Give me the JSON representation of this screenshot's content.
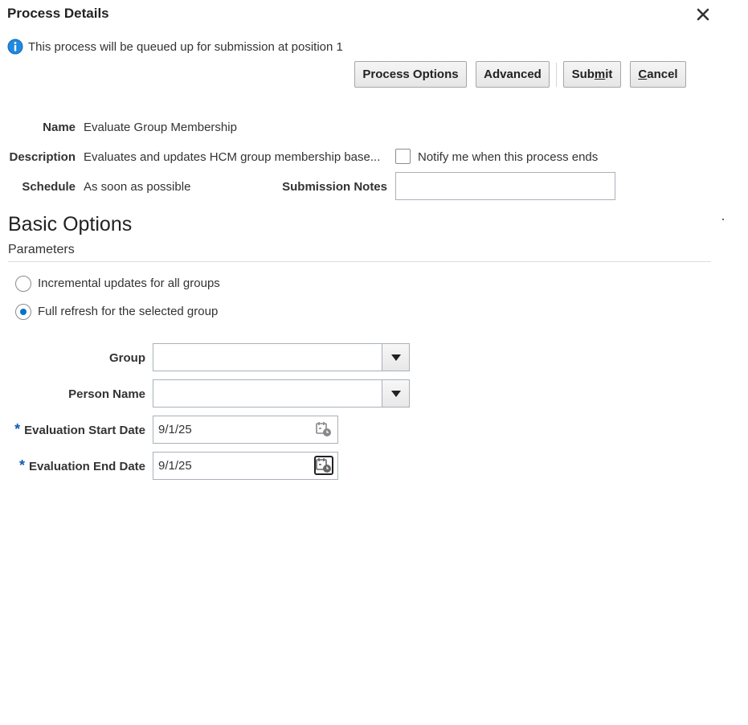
{
  "dialog": {
    "title": "Process Details",
    "info_message": "This process will be queued up for submission at position 1"
  },
  "toolbar": {
    "process_options_label": "Process Options",
    "advanced_label": "Advanced",
    "submit_pre": "Sub",
    "submit_mnemonic": "m",
    "submit_post": "it",
    "cancel_mnemonic": "C",
    "cancel_post": "ancel"
  },
  "details": {
    "name_label": "Name",
    "name_value": "Evaluate Group Membership",
    "description_label": "Description",
    "description_value": "Evaluates and updates HCM group membership base...",
    "notify_label": "Notify me when this process ends",
    "notify_checked": false,
    "schedule_label": "Schedule",
    "schedule_value": "As soon as possible",
    "submission_notes_label": "Submission Notes",
    "submission_notes_value": ""
  },
  "basic_options": {
    "heading": "Basic Options",
    "subheading": "Parameters",
    "radio_options": [
      {
        "label": "Incremental updates for all groups",
        "selected": false
      },
      {
        "label": "Full refresh for the selected group",
        "selected": true
      }
    ],
    "group_label": "Group",
    "group_value": "",
    "person_name_label": "Person Name",
    "person_name_value": "",
    "required_marker": "*",
    "start_date_label": "Evaluation Start Date",
    "start_date_value": "9/1/25",
    "end_date_label": "Evaluation End Date",
    "end_date_value": "9/1/25"
  },
  "colors": {
    "accent": "#0572ce",
    "required": "#0d5bb5",
    "info_icon": "#1f8ae0"
  },
  "icons": [
    "close-icon",
    "info-icon",
    "chevron-down-icon",
    "calendar-icon"
  ]
}
